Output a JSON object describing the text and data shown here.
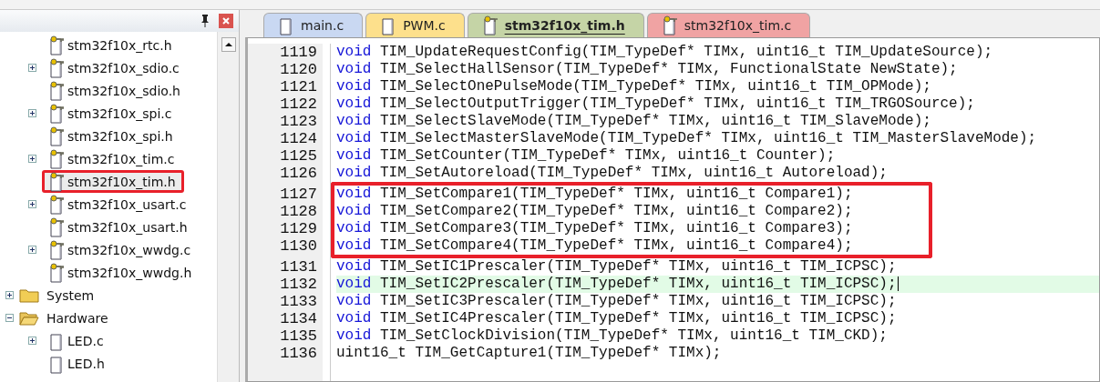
{
  "project_panel": {
    "files": [
      {
        "label": "stm32f10x_rtc.h",
        "expandable": false,
        "locked": true,
        "selected": false,
        "boxed": false
      },
      {
        "label": "stm32f10x_sdio.c",
        "expandable": true,
        "locked": true,
        "selected": false,
        "boxed": false
      },
      {
        "label": "stm32f10x_sdio.h",
        "expandable": false,
        "locked": true,
        "selected": false,
        "boxed": false
      },
      {
        "label": "stm32f10x_spi.c",
        "expandable": true,
        "locked": true,
        "selected": false,
        "boxed": false
      },
      {
        "label": "stm32f10x_spi.h",
        "expandable": false,
        "locked": true,
        "selected": false,
        "boxed": false
      },
      {
        "label": "stm32f10x_tim.c",
        "expandable": true,
        "locked": true,
        "selected": false,
        "boxed": false
      },
      {
        "label": "stm32f10x_tim.h",
        "expandable": false,
        "locked": true,
        "selected": true,
        "boxed": true
      },
      {
        "label": "stm32f10x_usart.c",
        "expandable": true,
        "locked": true,
        "selected": false,
        "boxed": false
      },
      {
        "label": "stm32f10x_usart.h",
        "expandable": false,
        "locked": true,
        "selected": false,
        "boxed": false
      },
      {
        "label": "stm32f10x_wwdg.c",
        "expandable": true,
        "locked": true,
        "selected": false,
        "boxed": false
      },
      {
        "label": "stm32f10x_wwdg.h",
        "expandable": false,
        "locked": true,
        "selected": false,
        "boxed": false
      }
    ],
    "folders": [
      {
        "label": "System",
        "expanded": false
      },
      {
        "label": "Hardware",
        "expanded": true,
        "children": [
          {
            "label": "LED.c",
            "expandable": true,
            "locked": false,
            "selected": false,
            "boxed": false
          },
          {
            "label": "LED.h",
            "expandable": false,
            "locked": false,
            "selected": false,
            "boxed": false
          }
        ]
      }
    ]
  },
  "tabs": [
    {
      "label": "main.c",
      "color": "#c9d8f2",
      "locked": false,
      "selected": false
    },
    {
      "label": "PWM.c",
      "color": "#fde08c",
      "locked": false,
      "selected": false
    },
    {
      "label": "stm32f10x_tim.h",
      "color": "#c5d4a6",
      "locked": true,
      "selected": true
    },
    {
      "label": "stm32f10x_tim.c",
      "color": "#f0a3a3",
      "locked": true,
      "selected": false
    }
  ],
  "code_lines": [
    {
      "number": "1119",
      "keyword": "void",
      "text": "TIM_UpdateRequestConfig(TIM_TypeDef* TIMx, uint16_t TIM_UpdateSource);",
      "current": false,
      "boxed": false
    },
    {
      "number": "1120",
      "keyword": "void",
      "text": "TIM_SelectHallSensor(TIM_TypeDef* TIMx, FunctionalState NewState);",
      "current": false,
      "boxed": false
    },
    {
      "number": "1121",
      "keyword": "void",
      "text": "TIM_SelectOnePulseMode(TIM_TypeDef* TIMx, uint16_t TIM_OPMode);",
      "current": false,
      "boxed": false
    },
    {
      "number": "1122",
      "keyword": "void",
      "text": "TIM_SelectOutputTrigger(TIM_TypeDef* TIMx, uint16_t TIM_TRGOSource);",
      "current": false,
      "boxed": false
    },
    {
      "number": "1123",
      "keyword": "void",
      "text": "TIM_SelectSlaveMode(TIM_TypeDef* TIMx, uint16_t TIM_SlaveMode);",
      "current": false,
      "boxed": false
    },
    {
      "number": "1124",
      "keyword": "void",
      "text": "TIM_SelectMasterSlaveMode(TIM_TypeDef* TIMx, uint16_t TIM_MasterSlaveMode);",
      "current": false,
      "boxed": false
    },
    {
      "number": "1125",
      "keyword": "void",
      "text": "TIM_SetCounter(TIM_TypeDef* TIMx, uint16_t Counter);",
      "current": false,
      "boxed": false
    },
    {
      "number": "1126",
      "keyword": "void",
      "text": "TIM_SetAutoreload(TIM_TypeDef* TIMx, uint16_t Autoreload);",
      "current": false,
      "boxed": false
    },
    {
      "number": "1127",
      "keyword": "void",
      "text": "TIM_SetCompare1(TIM_TypeDef* TIMx, uint16_t Compare1);",
      "current": false,
      "boxed": true
    },
    {
      "number": "1128",
      "keyword": "void",
      "text": "TIM_SetCompare2(TIM_TypeDef* TIMx, uint16_t Compare2);",
      "current": false,
      "boxed": true
    },
    {
      "number": "1129",
      "keyword": "void",
      "text": "TIM_SetCompare3(TIM_TypeDef* TIMx, uint16_t Compare3);",
      "current": false,
      "boxed": true
    },
    {
      "number": "1130",
      "keyword": "void",
      "text": "TIM_SetCompare4(TIM_TypeDef* TIMx, uint16_t Compare4);",
      "current": false,
      "boxed": true
    },
    {
      "number": "1131",
      "keyword": "void",
      "text": "TIM_SetIC1Prescaler(TIM_TypeDef* TIMx, uint16_t TIM_ICPSC);",
      "current": false,
      "boxed": false
    },
    {
      "number": "1132",
      "keyword": "void",
      "text": "TIM_SetIC2Prescaler(TIM_TypeDef* TIMx, uint16_t TIM_ICPSC);",
      "current": true,
      "boxed": false
    },
    {
      "number": "1133",
      "keyword": "void",
      "text": "TIM_SetIC3Prescaler(TIM_TypeDef* TIMx, uint16_t TIM_ICPSC);",
      "current": false,
      "boxed": false
    },
    {
      "number": "1134",
      "keyword": "void",
      "text": "TIM_SetIC4Prescaler(TIM_TypeDef* TIMx, uint16_t TIM_ICPSC);",
      "current": false,
      "boxed": false
    },
    {
      "number": "1135",
      "keyword": "void",
      "text": "TIM_SetClockDivision(TIM_TypeDef* TIMx, uint16_t TIM_CKD);",
      "current": false,
      "boxed": false
    },
    {
      "number": "1136",
      "text": "uint16_t TIM_GetCapture1(TIM_TypeDef* TIMx);",
      "current": false,
      "boxed": false
    }
  ]
}
